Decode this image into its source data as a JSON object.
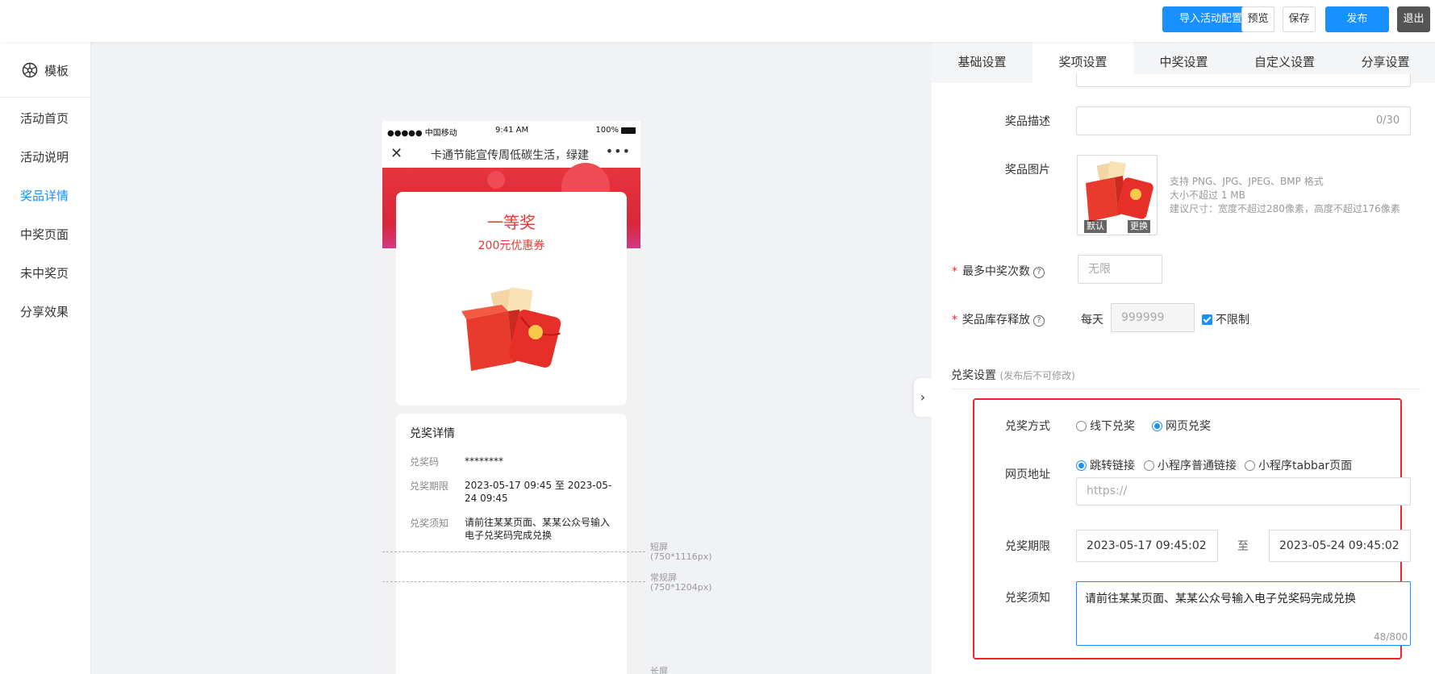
{
  "topbar": {
    "import_label": "导入活动配置",
    "preview_label": "预览",
    "save_label": "保存",
    "publish_label": "发布",
    "exit_label": "退出"
  },
  "sidebar": {
    "brand": "模板",
    "items": [
      {
        "label": "活动首页"
      },
      {
        "label": "活动说明"
      },
      {
        "label": "奖品详情",
        "active": true
      },
      {
        "label": "中奖页面"
      },
      {
        "label": "未中奖页"
      },
      {
        "label": "分享效果"
      }
    ]
  },
  "phone": {
    "carrier": "●●●●● 中国移动",
    "time": "9:41 AM",
    "battery": "100%",
    "title": "卡通节能宣传周低碳生活，绿建",
    "prize_name": "一等奖",
    "prize_sub": "200元优惠券",
    "detail": {
      "title": "兑奖详情",
      "code_label": "兑奖码",
      "code_value": "********",
      "period_label": "兑奖期限",
      "period_value": "2023-05-17 09:45 至 2023-05-24 09:45",
      "notice_label": "兑奖须知",
      "notice_value": "请前往某某页面、某某公众号输入电子兑奖码完成兑换"
    }
  },
  "screen_marks": [
    {
      "name": "短屏",
      "size": "(750*1116px)"
    },
    {
      "name": "常规屏",
      "size": "(750*1204px)"
    },
    {
      "name": "长屏"
    }
  ],
  "tabs": [
    "基础设置",
    "奖项设置",
    "中奖设置",
    "自定义设置",
    "分享设置"
  ],
  "active_tab": "奖项设置",
  "form": {
    "desc_label": "奖品描述",
    "desc_counter": "0/30",
    "image_label": "奖品图片",
    "image_default": "默认",
    "image_replace": "更换",
    "image_hints": [
      "支持 PNG、JPG、JPEG、BMP 格式",
      "大小不超过 1 MB",
      "建议尺寸：宽度不超过280像素，高度不超过176像素"
    ],
    "max_win_label": "最多中奖次数",
    "max_win_placeholder": "无限",
    "stock_label": "奖品库存释放",
    "stock_daily": "每天",
    "stock_value": "999999",
    "stock_unlimited": "不限制",
    "question_icon": "?"
  },
  "redeem": {
    "section_title": "兑奖设置",
    "section_note": "(发布后不可修改)",
    "method_label": "兑奖方式",
    "method_options": [
      {
        "label": "线下兑奖",
        "checked": false
      },
      {
        "label": "网页兑奖",
        "checked": true
      }
    ],
    "url_label": "网页地址",
    "url_options": [
      {
        "label": "跳转链接",
        "checked": true
      },
      {
        "label": "小程序普通链接",
        "checked": false
      },
      {
        "label": "小程序tabbar页面",
        "checked": false
      }
    ],
    "url_placeholder": "https://",
    "period_label": "兑奖期限",
    "start": "2023-05-17 09:45:02",
    "to": "至",
    "end": "2023-05-24 09:45:02",
    "notice_label": "兑奖须知",
    "notice_value": "请前往某某页面、某某公众号输入电子兑奖码完成兑换",
    "notice_counter": "48/800"
  },
  "colors": {
    "accent": "#1890ff",
    "danger": "#f5222d",
    "prize_red": "#e53935"
  }
}
